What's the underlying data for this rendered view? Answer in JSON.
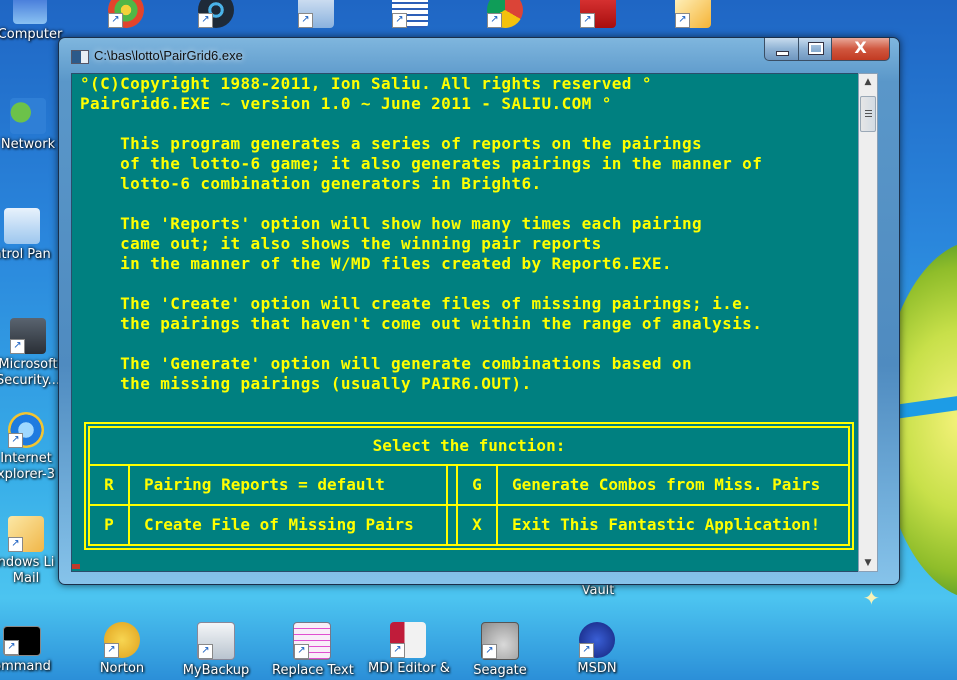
{
  "desktop": {
    "top_row_icons": [
      {
        "name": "computer",
        "label": "Computer"
      },
      {
        "name": "windows-media-center",
        "label": ""
      },
      {
        "name": "media-player",
        "label": ""
      },
      {
        "name": "document-app",
        "label": ""
      },
      {
        "name": "microsoft-word",
        "label": ""
      },
      {
        "name": "google-chrome",
        "label": ""
      },
      {
        "name": "adobe-reader",
        "label": ""
      },
      {
        "name": "utility-app",
        "label": ""
      }
    ],
    "left_icons": [
      {
        "name": "network",
        "label": "Network"
      },
      {
        "name": "control-panel",
        "label": "ntrol Pan"
      },
      {
        "name": "microsoft-security",
        "label": "Microsoft\nSecurity..."
      },
      {
        "name": "internet-explorer",
        "label": "Internet\nxplorer-3"
      },
      {
        "name": "windows-live-mail",
        "label": "ndows Li\nMail"
      },
      {
        "name": "command-prompt",
        "label": "ommand"
      }
    ],
    "bottom_icons": [
      {
        "name": "norton",
        "label": "Norton"
      },
      {
        "name": "mybackup",
        "label": "MyBackup"
      },
      {
        "name": "replace-text",
        "label": "Replace Text"
      },
      {
        "name": "mdi-editor",
        "label": "MDI Editor &"
      },
      {
        "name": "seagate",
        "label": "Seagate"
      },
      {
        "name": "msdn",
        "label": "MSDN"
      }
    ],
    "vault_label": "Vault"
  },
  "window": {
    "title": "C:\\bas\\lotto\\PairGrid6.exe",
    "controls": {
      "minimize": "minimize",
      "maximize": "maximize",
      "close": "X"
    }
  },
  "console": {
    "colors": {
      "background": "#008080",
      "text": "#ffff00"
    },
    "lines": [
      "°(C)Copyright 1988-2011, Ion Saliu. All rights reserved °",
      "PairGrid6.EXE ~ version 1.0 ~ June 2011 - SALIU.COM °",
      "",
      "    This program generates a series of reports on the pairings",
      "    of the lotto-6 game; it also generates pairings in the manner of",
      "    lotto-6 combination generators in Bright6.",
      "",
      "    The 'Reports' option will show how many times each pairing",
      "    came out; it also shows the winning pair reports",
      "    in the manner of the W/MD files created by Report6.EXE.",
      "",
      "    The 'Create' option will create files of missing pairings; i.e.",
      "    the pairings that haven't come out within the range of analysis.",
      "",
      "    The 'Generate' option will generate combinations based on",
      "    the missing pairings (usually PAIR6.OUT)."
    ],
    "menu": {
      "heading": "Select the function:",
      "options": [
        {
          "key": "R",
          "label": "Pairing Reports = default"
        },
        {
          "key": "G",
          "label": "Generate Combos from Miss. Pairs"
        },
        {
          "key": "P",
          "label": "Create File of Missing Pairs"
        },
        {
          "key": "X",
          "label": "Exit This Fantastic Application!"
        }
      ]
    }
  },
  "scrollbar": {
    "up": "▲",
    "down": "▼"
  }
}
